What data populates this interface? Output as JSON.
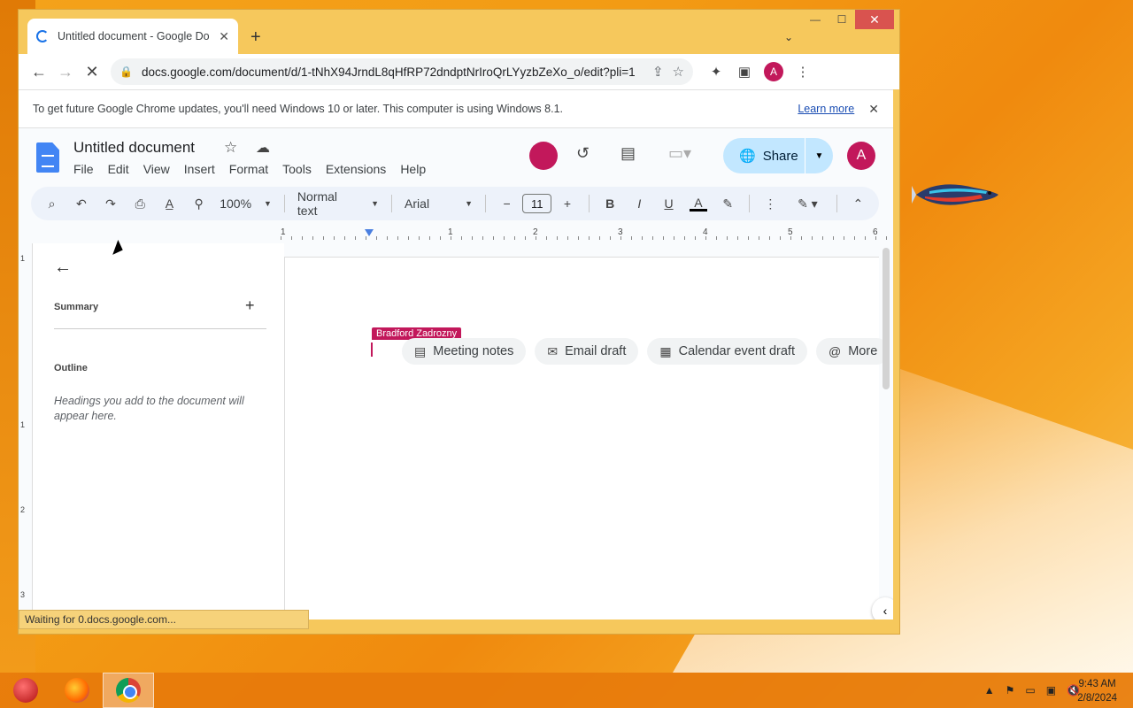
{
  "browser": {
    "tab_title": "Untitled document - Google Docs",
    "new_tab_label": "+",
    "url": "docs.google.com/document/d/1-tNhX94JrndL8qHfRP72dndptNrIroQrLYyzbZeXo_o/edit?pli=1",
    "profile_initial": "A"
  },
  "infobar": {
    "message": "To get future Google Chrome updates, you'll need Windows 10 or later. This computer is using Windows 8.1.",
    "link": "Learn more"
  },
  "docs": {
    "title": "Untitled document",
    "menu": [
      "File",
      "Edit",
      "View",
      "Insert",
      "Format",
      "Tools",
      "Extensions",
      "Help"
    ],
    "share_label": "Share",
    "account_initial": "A",
    "zoom": "100%",
    "style": "Normal text",
    "font": "Arial",
    "font_size": "11",
    "ruler_numbers": [
      "1",
      "1",
      "2",
      "3",
      "4",
      "5",
      "6"
    ],
    "vruler_numbers": [
      "1",
      "1",
      "2",
      "3"
    ]
  },
  "outline": {
    "summary_label": "Summary",
    "outline_label": "Outline",
    "hint": "Headings you add to the document will appear here."
  },
  "page": {
    "collaborator": "Bradford Zadrozny",
    "chips": [
      "Meeting notes",
      "Email draft",
      "Calendar event draft",
      "More"
    ]
  },
  "status": "Waiting for 0.docs.google.com...",
  "taskbar": {
    "time": "9:43 AM",
    "date": "2/8/2024"
  },
  "colors": {
    "accent": "#c2185b",
    "share_bg": "#c2e7ff",
    "docs_blue": "#4285f4"
  }
}
